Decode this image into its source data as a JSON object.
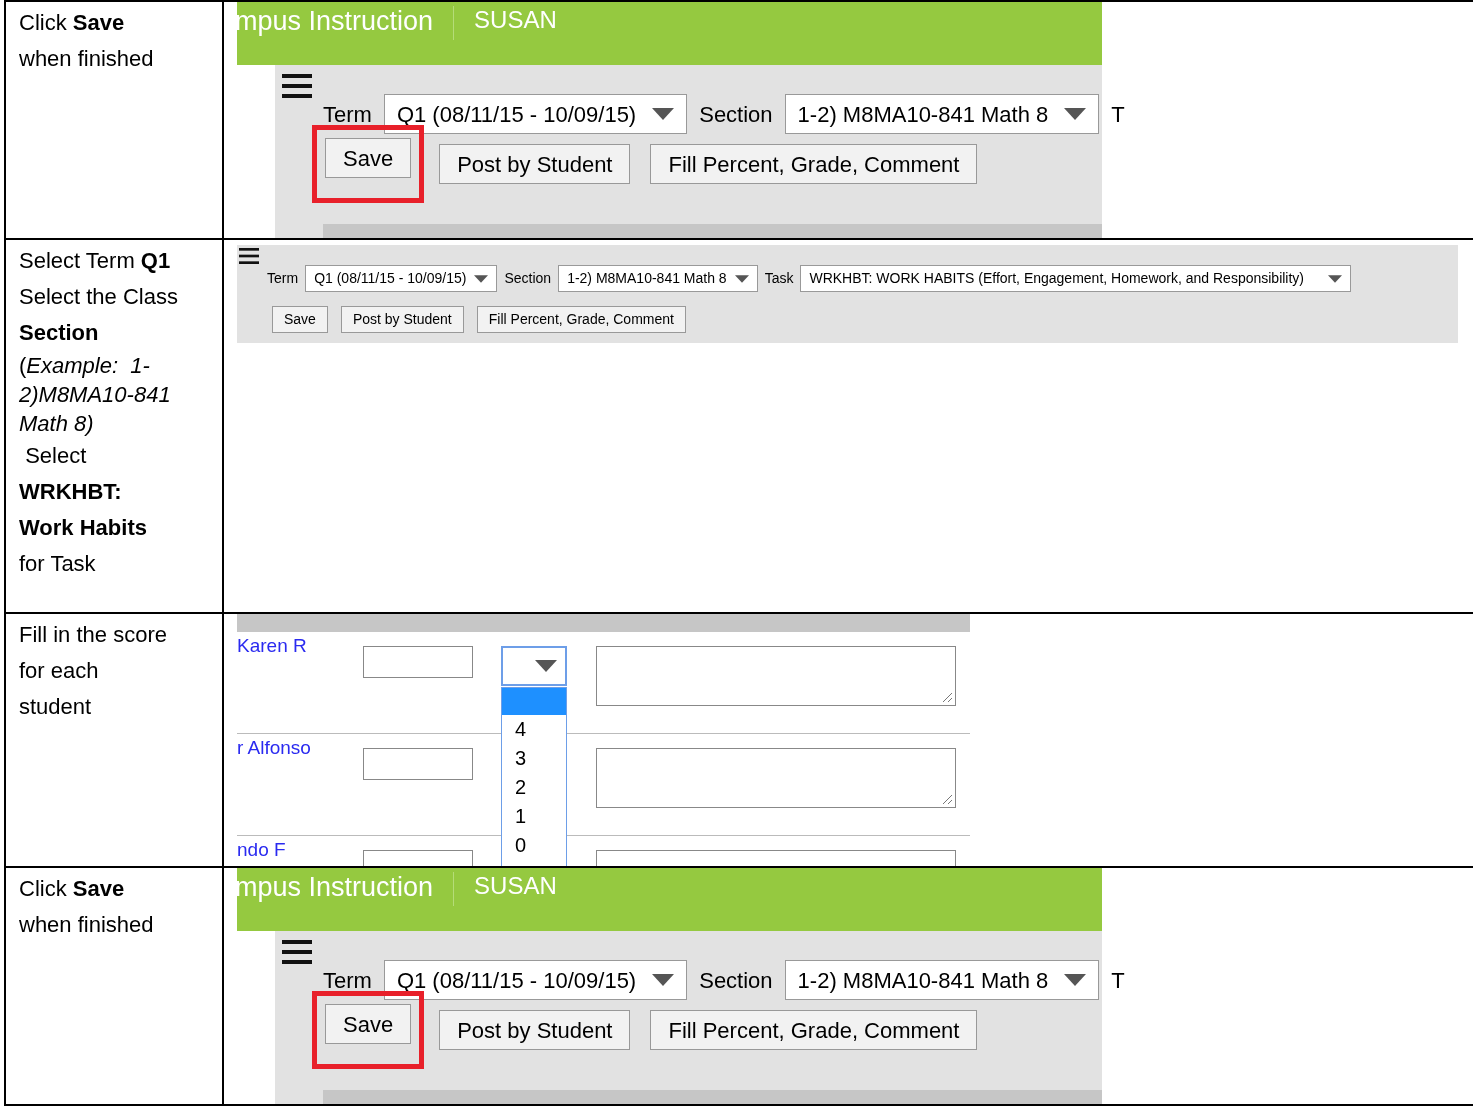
{
  "rows": [
    {
      "kind": "zoomed",
      "instructions": [
        "Click **Save**",
        "when finished"
      ],
      "screen": {
        "header": {
          "title": "mpus Instruction",
          "user": "SUSAN"
        },
        "term_label": "Term",
        "term": "Q1 (08/11/15 - 10/09/15)",
        "section_label": "Section",
        "section": "1-2) M8MA10-841 Math 8",
        "cut_label": "T",
        "buttons": [
          {
            "label": "Save",
            "highlighted": true
          },
          {
            "label": "Post by Student",
            "highlighted": false
          },
          {
            "label": "Fill Percent, Grade, Comment",
            "highlighted": false
          }
        ]
      }
    },
    {
      "kind": "compact",
      "instructions": [
        "Select Term **Q1**",
        "Select the Class",
        "**Section**",
        "(*Example:  1-2)M8MA10-841 Math 8)*",
        " Select",
        "**WRKHBT:**",
        "**Work Habits**",
        "for Task"
      ],
      "screen": {
        "term_label": "Term",
        "term": "Q1 (08/11/15 - 10/09/15)",
        "section_label": "Section",
        "section": "1-2) M8MA10-841 Math 8",
        "task_label": "Task",
        "task": "WRKHBT: WORK HABITS (Effort, Engagement, Homework, and Responsibility)",
        "buttons": [
          {
            "label": "Save",
            "highlighted": false
          },
          {
            "label": "Post by Student",
            "highlighted": false
          },
          {
            "label": "Fill Percent, Grade, Comment",
            "highlighted": false
          }
        ]
      }
    },
    {
      "kind": "grades",
      "instructions": [
        "Fill in the score",
        "for each",
        "student"
      ],
      "screen": {
        "students": [
          {
            "name": "Karen R",
            "dropdown_open": true
          },
          {
            "name": "r Alfonso",
            "dropdown_open": false
          },
          {
            "name": "ndo F",
            "dropdown_open": false
          }
        ],
        "grade_options": {
          "blank_selected": true,
          "options": [
            "4",
            "3",
            "2",
            "1",
            "0"
          ]
        }
      }
    },
    {
      "kind": "zoomed",
      "instructions": [
        "Click **Save**",
        "when finished"
      ],
      "screen": {
        "header": {
          "title": "mpus Instruction",
          "user": "SUSAN"
        },
        "term_label": "Term",
        "term": "Q1 (08/11/15 - 10/09/15)",
        "section_label": "Section",
        "section": "1-2) M8MA10-841 Math 8",
        "cut_label": "T",
        "buttons": [
          {
            "label": "Save",
            "highlighted": true
          },
          {
            "label": "Post by Student",
            "highlighted": false
          },
          {
            "label": "Fill Percent, Grade, Comment",
            "highlighted": false
          }
        ]
      }
    }
  ]
}
